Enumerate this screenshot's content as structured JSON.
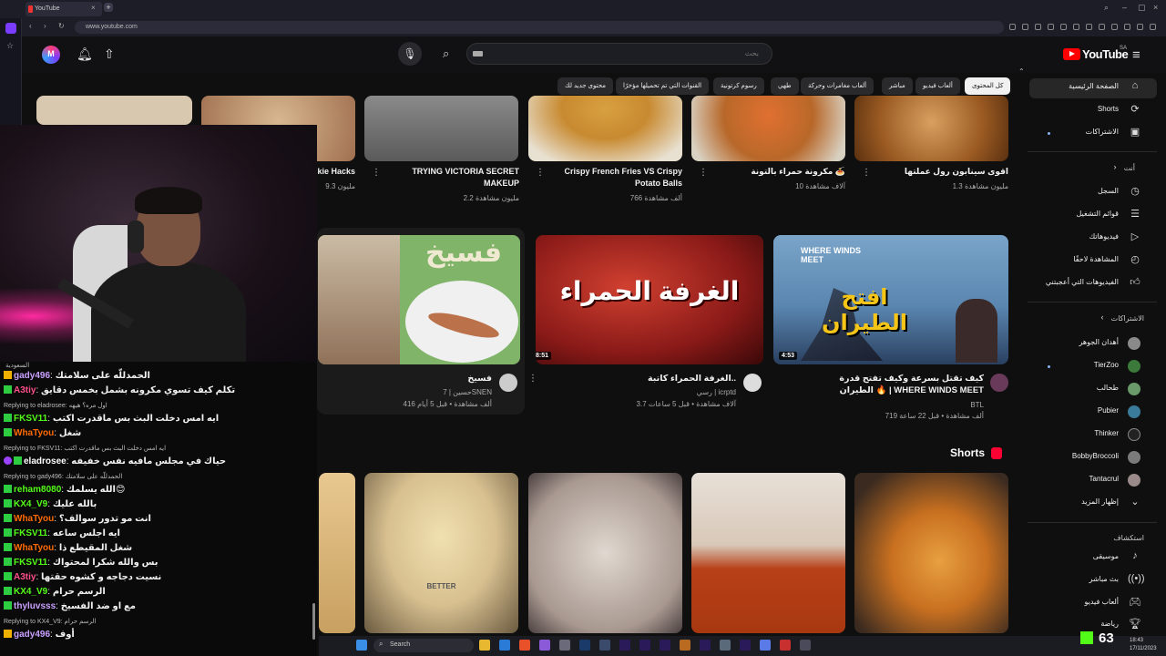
{
  "browser": {
    "tab_title": "YouTube",
    "url": "www.youtube.com"
  },
  "header": {
    "search_placeholder": "بحث",
    "logo_text": "YouTube",
    "logo_region": "SA"
  },
  "chips": [
    "كل المحتوى",
    "ألعاب فيديو",
    "مباشر",
    "ألعاب مغامرات وحركة",
    "طهي",
    "رسوم كرتونية",
    "القنوات التي تم تحميلها مؤخرًا",
    "محتوى جديد لك"
  ],
  "sidebar": {
    "home": "الصفحة الرئيسية",
    "shorts": "Shorts",
    "subscriptions": "الاشتراكات",
    "you_header": "أنت",
    "history": "السجل",
    "playlists": "قوائم التشغيل",
    "your_videos": "فيديوهاتك",
    "watch_later": "المشاهدة لاحقًا",
    "liked": "الفيديوهات التي أعجبتني",
    "subs_header": "الاشتراكات",
    "subs": [
      {
        "name": "أهدان الجوهر",
        "color": "#8a8a8a"
      },
      {
        "name": "TierZoo",
        "color": "#3b7a3a"
      },
      {
        "name": "طحالب",
        "color": "#6a9a6a"
      },
      {
        "name": "Pubier",
        "color": "#3a7a9a"
      },
      {
        "name": "Thinker",
        "color": "#222"
      },
      {
        "name": "BobbyBroccoli",
        "color": "#7a7a7a"
      },
      {
        "name": "Tantacrul",
        "color": "#9a8a8a"
      }
    ],
    "show_more": "إظهار المزيد",
    "explore_header": "استكشاف",
    "music": "موسيقى",
    "live": "بث مباشر",
    "gaming": "ألعاب فيديو",
    "sports": "رياضة"
  },
  "row1": [
    {
      "title": "اقوى سينابون رول عملتها",
      "meta": "1.3 مليون مشاهدة",
      "color": "#9a5a22"
    },
    {
      "title": "مكرونة حمراء بالتونة 🍝",
      "meta": "10 آلاف مشاهدة",
      "color": "#b8682a"
    },
    {
      "title": "Crispy French Fries VS Crispy Potato Balls",
      "meta": "766 ألف مشاهدة",
      "color": "#c88a30"
    },
    {
      "title": "TRYING VICTORIA SECRET MAKEUP",
      "meta": "2.2 مليون مشاهدة",
      "color": "#6a6a6a"
    },
    {
      "title": "kie Hacks",
      "meta": "9.3 مليون",
      "color": "#c8a880"
    }
  ],
  "row2": [
    {
      "title": "كيف تقتل بسرعة وكيف تفتح قدرة الطيران 🔥 | WHERE WINDS MEET",
      "channel": "BTL",
      "meta": "719 ألف مشاهدة • قبل 22 ساعة",
      "duration": "4:53",
      "thumb_text": "افتح الطيران",
      "thumb_small": "WHERE WINDS MEET"
    },
    {
      "title": "الغرفة الحمراء كاتبة..",
      "channel": "رسي | icrptd",
      "meta": "3.7 آلاف مشاهدة • قبل 5 ساعات",
      "duration": "8:51",
      "thumb_text": "الغرفة الحمراء"
    },
    {
      "title": "فسيخ",
      "channel": "حسين | 7SNEN",
      "meta": "416 ألف مشاهدة • قبل 5 أيام",
      "thumb_text": "فسيخ"
    }
  ],
  "shorts": {
    "title": "Shorts",
    "better_label": "BETTER"
  },
  "chat": {
    "country": "السعودية",
    "messages": [
      {
        "user": "gady496",
        "color": "#c9a0ff",
        "badge": "crown",
        "msg": "الحمدللّه على سلامتك"
      },
      {
        "user": "A3tiy",
        "color": "#ff4f8a",
        "badge": "green",
        "msg": "تكلم كيف تسوي مكرونه بشمل بخمس دقايق"
      },
      {
        "reply": "Replying to eladrosee: اول مره؟ هيهه"
      },
      {
        "user": "FKSV11",
        "color": "#53fc18",
        "badge": "green",
        "msg": "ايه امس دخلت البث بس ماقدرت اكتب"
      },
      {
        "user": "WhaTyou",
        "color": "#ff6a00",
        "badge": "green",
        "msg": "شغل"
      },
      {
        "reply": "Replying to FKSV11: ايه امس دخلت البث بس ماقدرت اكتب"
      },
      {
        "user": "eladrosee",
        "color": "#ffffff",
        "badge": "pur",
        "msg": "حياك في مجلس مافيه نفس خفيفه"
      },
      {
        "reply": "Replying to gady496: الحمدللّه على سلامتك"
      },
      {
        "user": "reham8080",
        "color": "#53fc18",
        "badge": "green",
        "msg": "الله يسلمك😊"
      },
      {
        "user": "KX4_V9",
        "color": "#53fc18",
        "badge": "green",
        "msg": "بالله عليك"
      },
      {
        "user": "WhaTyou",
        "color": "#ff6a00",
        "badge": "green",
        "msg": "انت مو تدور سوالف؟"
      },
      {
        "user": "FKSV11",
        "color": "#53fc18",
        "badge": "green",
        "msg": "ايه اجلس ساعه"
      },
      {
        "user": "WhaTyou",
        "color": "#ff6a00",
        "badge": "green",
        "msg": "شغل المقيطع ذا"
      },
      {
        "user": "FKSV11",
        "color": "#53fc18",
        "badge": "green",
        "msg": "بس والله شكرا لمحتواك"
      },
      {
        "user": "A3tiy",
        "color": "#ff4f8a",
        "badge": "green",
        "msg": "نسيت دجاجه و كشوه حقتها"
      },
      {
        "user": "KX4_V9",
        "color": "#53fc18",
        "badge": "green",
        "msg": "الرسم حرام"
      },
      {
        "user": "thyluvsss",
        "color": "#c9a0ff",
        "badge": "green",
        "msg": "مع او ضد الفسيخ"
      },
      {
        "reply": "Replying to KX4_V9: الرسم حرام"
      },
      {
        "user": "gady496",
        "color": "#c9a0ff",
        "badge": "crown",
        "msg": "أوف"
      }
    ]
  },
  "taskbar": {
    "search": "Search",
    "kick_count": "63",
    "time": "18:43",
    "date": "17/11/2023"
  }
}
